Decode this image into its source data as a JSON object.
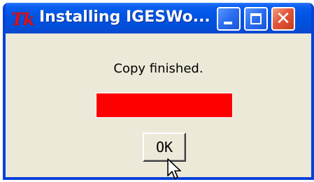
{
  "window": {
    "title": "Installing IGESWo...",
    "app_icon_text": "Tk",
    "controls": {
      "minimize_icon": "minimize-icon",
      "maximize_icon": "maximize-icon",
      "close_icon": "close-icon"
    }
  },
  "dialog": {
    "message": "Copy finished.",
    "progress": {
      "value": 1.0,
      "color": "#ff0000"
    },
    "ok_label": "OK"
  },
  "colors": {
    "titlebar": "#0054e3",
    "body": "#ece9d8",
    "close_button": "#e2553a"
  }
}
